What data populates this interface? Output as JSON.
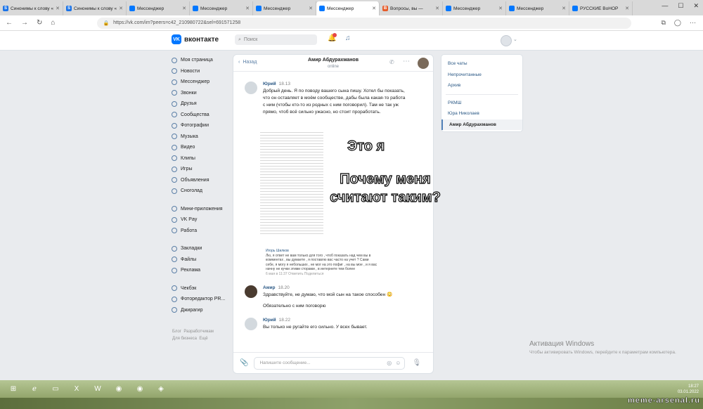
{
  "browser": {
    "tabs": [
      {
        "label": "Синонимы к слову «",
        "color": "#1a73e8",
        "glyph": "S"
      },
      {
        "label": "Синонимы к слову «",
        "color": "#1a73e8",
        "glyph": "S"
      },
      {
        "label": "Мессенджер",
        "color": "#0077ff",
        "glyph": ""
      },
      {
        "label": "Мессенджер",
        "color": "#0077ff",
        "glyph": ""
      },
      {
        "label": "Мессенджер",
        "color": "#0077ff",
        "glyph": ""
      },
      {
        "label": "Мессенджер",
        "color": "#0077ff",
        "glyph": "",
        "active": true
      },
      {
        "label": "Вопросы, вы — ",
        "color": "#e65c2a",
        "glyph": "В"
      },
      {
        "label": "Мессенджер",
        "color": "#0077ff",
        "glyph": ""
      },
      {
        "label": "Мессенджер",
        "color": "#0077ff",
        "glyph": ""
      },
      {
        "label": "РУССКИЕ ВоНОР",
        "color": "#0077ff",
        "glyph": ""
      }
    ],
    "url": "https://vk.com/im?peers=c42_210980722&sel=691571258"
  },
  "vk": {
    "logo_text": "вконтакте",
    "search_placeholder": "Поиск",
    "menu": [
      "Моя страница",
      "Новости",
      "Мессенджер",
      "Звонки",
      "Друзья",
      "Сообщества",
      "Фотографии",
      "Музыка",
      "Видео",
      "Клипы",
      "Игры",
      "Объявления",
      "Сноголад",
      "Мини-приложения",
      "VK Pay",
      "Работа",
      "Закладки",
      "Файлы",
      "Реклама",
      "Чекбэк",
      "Фоторедактор PR...",
      "Джирагир"
    ],
    "footer": [
      "Блог",
      "Разработчикам",
      "Для бизнеса",
      "Ещё"
    ]
  },
  "chat": {
    "back": "Назад",
    "title": "Амир Абдурахманов",
    "status": "online",
    "messages": [
      {
        "author": "Юрий",
        "time": "18.13",
        "text": "Добрый день. Я по поводу вашего сына пишу. Хотел бы показать, что он оставляет в моём сообществе, дабы была какая-то работа с ним (чтобы кто-то из родных с ним поговорил). Там не так уж прямо, чтоб всё сильно ужасно, но стоит проработать."
      },
      {
        "author": "Амир",
        "time": "18.20",
        "text": "Здравствуйте, не думаю, что мой сын на такое способен 😳",
        "text2": "Обязательно с ним поговорю"
      },
      {
        "author": "Юрий",
        "time": "18.22",
        "text": "Вы только не ругайте его сильно. У всех бывает."
      }
    ],
    "meme_line1": "Это я",
    "meme_line2": "Почему меня считают таким?",
    "reply_author": "Игорь Шилков",
    "reply_text": "Лю, я ответ не вам только для того , чтоб показать над чем вы в комментах , вы думаете , я поставлю вас часто на учет ? Сами себе, я могу я небольших , не мог на это пофиг , на вы мое , и я вас начну не кучки этими сторами , в интернете тем более",
    "reply_time": "6 мая в 11:37   Ответить   Поделиться",
    "composer_placeholder": "Напишите сообщение..."
  },
  "right_panel": {
    "items": [
      "Все чаты",
      "Непрочитанные",
      "Архив"
    ],
    "chats": [
      "РКМШ",
      "Юра Николаев",
      "Амир Абдурахманов"
    ],
    "selected": "Амир Абдурахманов"
  },
  "windows": {
    "activation_title": "Активация Windows",
    "activation_text": "Чтобы активировать Windows, перейдите к параметрам компьютера.",
    "clock_time": "18:27",
    "clock_date": "03.01.2022"
  },
  "watermark": "meme-arsenal.ru"
}
